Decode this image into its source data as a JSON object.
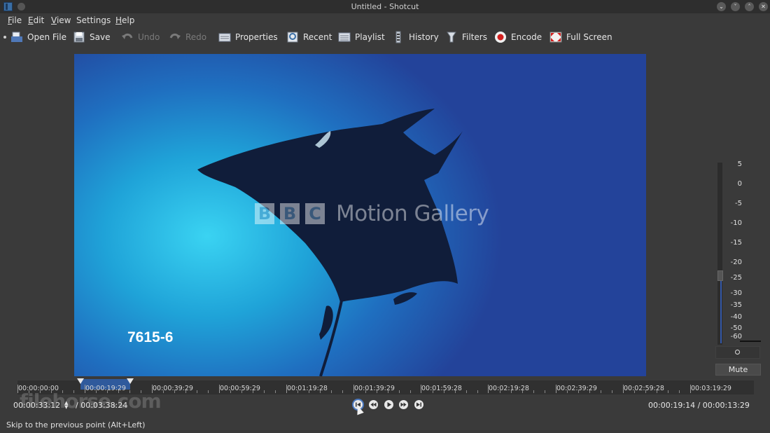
{
  "window": {
    "title": "Untitled - Shotcut",
    "buttons": [
      "minimize-icon",
      "collapse-icon",
      "maximize-icon",
      "close-icon"
    ]
  },
  "menu": [
    {
      "label": "File",
      "mnemonic": "F",
      "rest": "ile"
    },
    {
      "label": "Edit",
      "mnemonic": "E",
      "rest": "dit"
    },
    {
      "label": "View",
      "mnemonic": "V",
      "rest": "iew"
    },
    {
      "label": "Settings",
      "mnemonic": "",
      "rest": "Settings"
    },
    {
      "label": "Help",
      "mnemonic": "H",
      "rest": "elp"
    }
  ],
  "toolbar": {
    "open_file": "Open File",
    "save": "Save",
    "undo": "Undo",
    "redo": "Redo",
    "properties": "Properties",
    "recent": "Recent",
    "playlist": "Playlist",
    "history": "History",
    "filters": "Filters",
    "encode": "Encode",
    "full_screen": "Full Screen"
  },
  "video": {
    "watermark_letters": [
      "B",
      "B",
      "C"
    ],
    "watermark_text": "Motion Gallery",
    "tape_id": "7615-6"
  },
  "audio_meter": {
    "scale": [
      "5",
      "0",
      "-5",
      "-10",
      "-15",
      "-20",
      "-25",
      "-30",
      "-35",
      "-40",
      "-50",
      "-60"
    ],
    "mute_label": "Mute"
  },
  "timeline": {
    "ticks": [
      "00:00:00:00",
      "00:00:19:29",
      "00:00:39:29",
      "00:00:59:29",
      "00:01:19:28",
      "00:01:39:29",
      "00:01:59:28",
      "00:02:19:28",
      "00:02:39:29",
      "00:02:59:28",
      "00:03:19:29"
    ]
  },
  "transport": {
    "position": "00:00:33:12",
    "duration": "/ 00:03:38:24",
    "in_out": "00:00:19:14 / 00:00:13:29"
  },
  "watermark_site": "filehorse.com",
  "status_bar": "Skip to the previous point (Alt+Left)"
}
